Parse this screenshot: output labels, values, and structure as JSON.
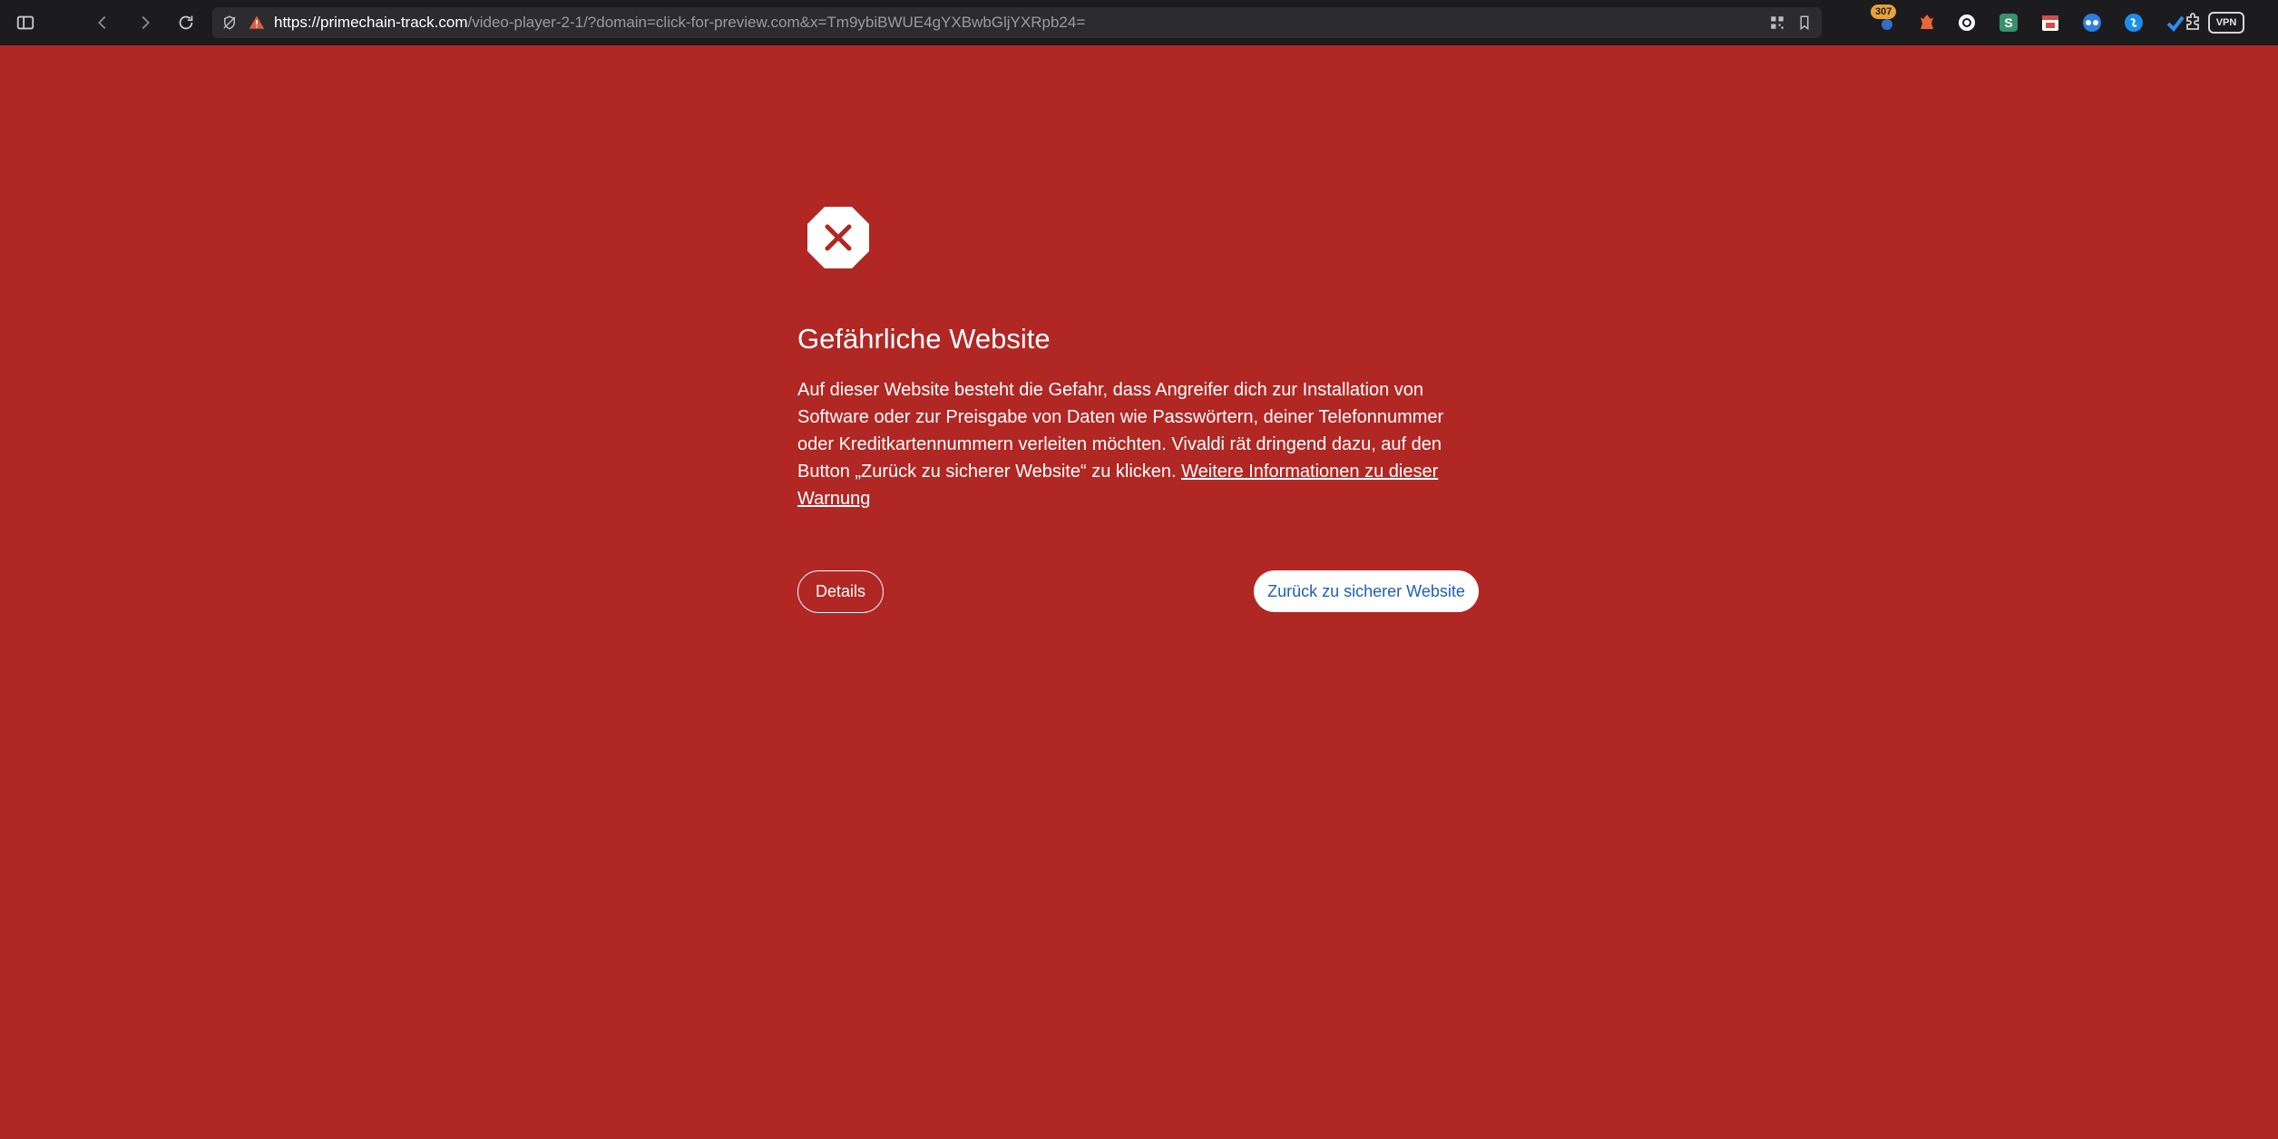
{
  "browser": {
    "url_host": "https://primechain-track.com",
    "url_path": "/video-player-2-1/?domain=click-for-preview.com&x=Tm9ybiBWUE4gYXBwbGljYXRpb24=",
    "extensions_badge": "307",
    "vpn_label": "VPN",
    "icons": [
      "panel-toggle-icon",
      "back-icon",
      "forward-icon",
      "reload-icon",
      "tracker-block-icon",
      "warning-triangle-icon",
      "qr-code-icon",
      "bookmark-icon",
      "extensions-puzzle-icon"
    ]
  },
  "warning": {
    "title": "Gefährliche Website",
    "body": "Auf dieser Website besteht die Gefahr, dass Angreifer dich zur Installation von Software oder zur Preisgabe von Daten wie Passwörtern, deiner Telefonnummer oder Kreditkartennummern verleiten möchten. Vivaldi rät dringend dazu, auf den Button „Zurück zu sicherer Website“ zu klicken. ",
    "learn_more_link": "Weitere Informationen zu dieser Warnung",
    "details_button": "Details",
    "back_button": "Zurück zu sicherer Website"
  },
  "colors": {
    "background": "#b02724",
    "toolbar": "#1c1c1e",
    "back_button_text": "#1f5fb7"
  }
}
